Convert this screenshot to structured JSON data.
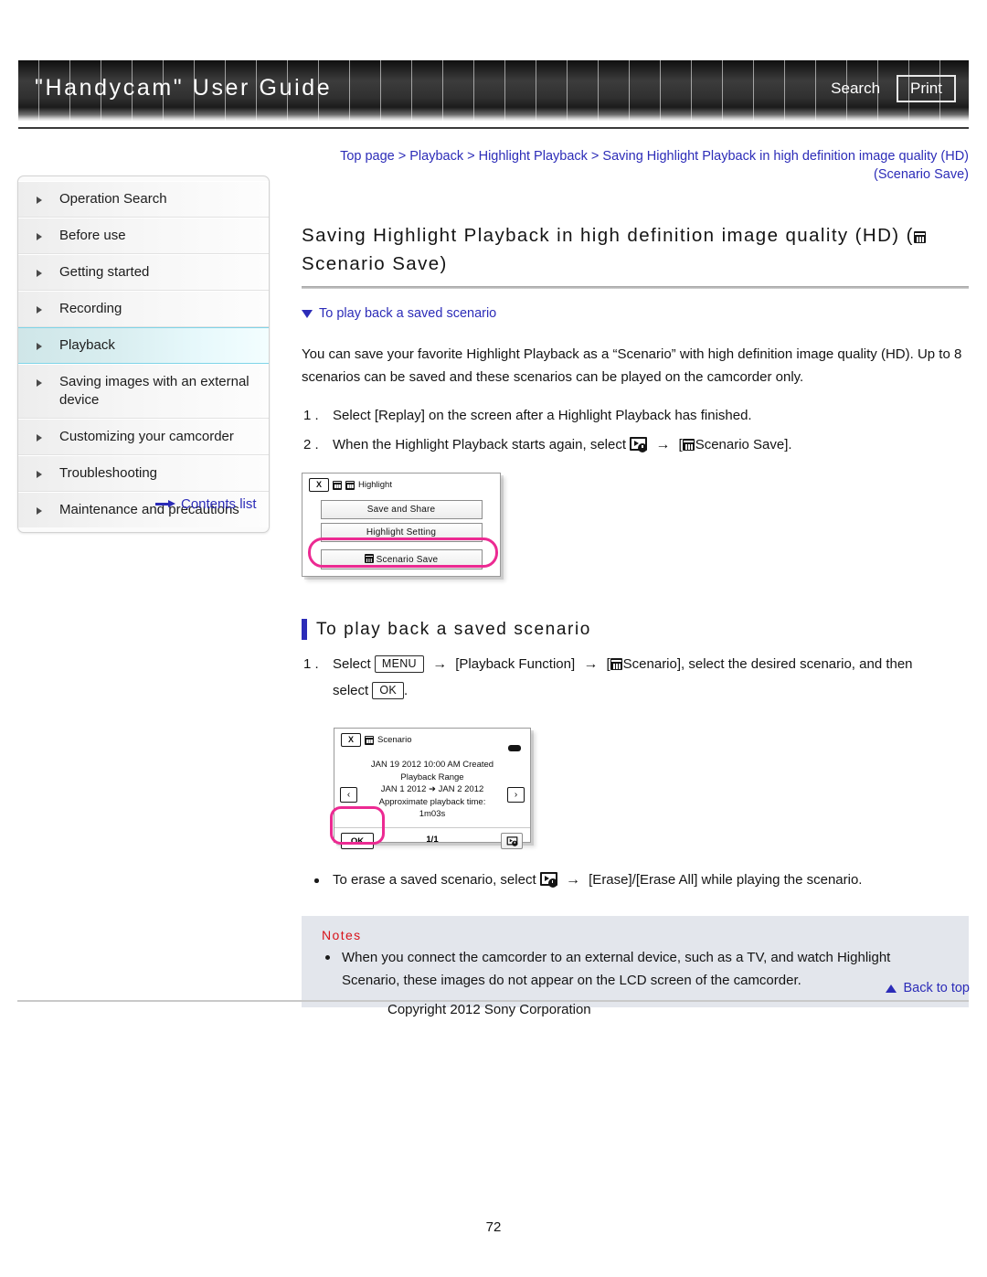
{
  "header": {
    "title": "\"Handycam\" User Guide",
    "search_label": "Search",
    "print_label": "Print"
  },
  "breadcrumb": {
    "text": "Top page > Playback > Highlight Playback > Saving Highlight Playback in high definition image quality (HD) (Scenario Save)"
  },
  "sidebar": {
    "items": [
      {
        "label": "Operation Search"
      },
      {
        "label": "Before use"
      },
      {
        "label": "Getting started"
      },
      {
        "label": "Recording"
      },
      {
        "label": "Playback"
      },
      {
        "label": "Saving images with an external device"
      },
      {
        "label": "Customizing your camcorder"
      },
      {
        "label": "Troubleshooting"
      },
      {
        "label": "Maintenance and precautions"
      }
    ],
    "active_index": 4,
    "contents_list_label": "Contents list"
  },
  "main": {
    "page_title_part1": "Saving Highlight Playback in high definition image quality (HD) (",
    "page_title_part2": "Scenario Save)",
    "toc_link": "To play back a saved scenario",
    "intro": "You can save your favorite Highlight Playback as a “Scenario” with high definition image quality (HD). Up to 8 scenarios can be saved and these scenarios can be played on the camcorder only.",
    "steps": [
      {
        "text_before": "Select [Replay] on the screen after a Highlight Playback has finished."
      },
      {
        "text_before": "When the Highlight Playback starts again, select",
        "text_after_icon": "[",
        "text_tail": "Scenario Save]."
      }
    ],
    "section_heading": "To play back a saved scenario",
    "play_step": {
      "select_label": "Select",
      "menu_key": "MENU",
      "playback_function": "[Playback Function]",
      "scenario_open": "[",
      "scenario_label": "Scenario], select the desired scenario, and then",
      "select2_label": "select",
      "ok_key": "OK",
      "period": "."
    },
    "erase_bullet": {
      "text_before": "To erase a saved scenario, select",
      "text_after": "[Erase]/[Erase All] while playing the scenario."
    },
    "notes": {
      "title": "Notes",
      "items": [
        "When you connect the camcorder to an external device, such as a TV, and watch Highlight Scenario, these images do not appear on the LCD screen of the camcorder."
      ]
    }
  },
  "lcd_highlight": {
    "close_label": "X",
    "title": "Highlight",
    "buttons": [
      "Save and Share",
      "Highlight Setting",
      "Scenario Save"
    ]
  },
  "lcd_scenario": {
    "close_label": "X",
    "title": "Scenario",
    "created_line": "JAN 19 2012 10:00 AM Created",
    "range_label": "Playback Range",
    "range_value": "JAN  1 2012 ➜ JAN  2 2012",
    "duration_label": "Approximate playback time:",
    "duration_value": "1m03s",
    "prev_label": "‹",
    "next_label": "›",
    "ok_label": "OK",
    "page_indicator": "1/1"
  },
  "footer": {
    "back_to_top": "Back to top",
    "copyright": "Copyright 2012 Sony Corporation",
    "page_number": "72"
  },
  "colors": {
    "link": "#2c2cb8",
    "notes_title": "#d8131a",
    "highlight_ring": "#ec2a92",
    "active_nav": "#7fd4e8"
  }
}
